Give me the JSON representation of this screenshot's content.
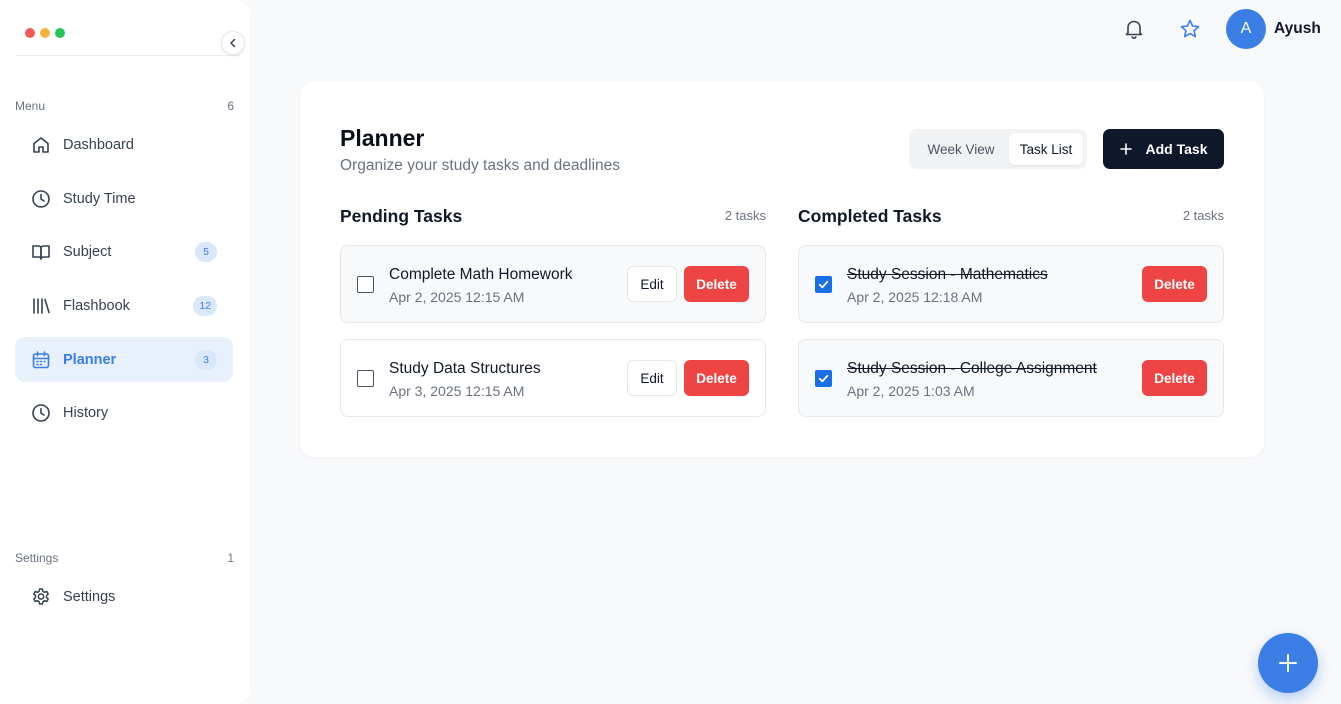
{
  "window": {
    "dot_colors": [
      "#ef5b5b",
      "#f5b53d",
      "#22c55e"
    ]
  },
  "sidebar": {
    "menu_label": "Menu",
    "menu_count": "6",
    "items": [
      {
        "label": "Dashboard",
        "icon": "home-icon",
        "badge": null,
        "active": false
      },
      {
        "label": "Study Time",
        "icon": "clock-icon",
        "badge": null,
        "active": false
      },
      {
        "label": "Subject",
        "icon": "book-icon",
        "badge": "5",
        "active": false
      },
      {
        "label": "Flashbook",
        "icon": "library-icon",
        "badge": "12",
        "active": false
      },
      {
        "label": "Planner",
        "icon": "calendar-icon",
        "badge": "3",
        "active": true
      },
      {
        "label": "History",
        "icon": "clock-icon",
        "badge": null,
        "active": false
      }
    ],
    "settings_label": "Settings",
    "settings_count": "1",
    "settings_items": [
      {
        "label": "Settings",
        "icon": "gear-icon"
      }
    ]
  },
  "topbar": {
    "bell_icon": "bell-icon",
    "star_icon": "star-icon",
    "avatar_initial": "A",
    "user_name": "Ayush"
  },
  "planner": {
    "title": "Planner",
    "subtitle": "Organize your study tasks and deadlines",
    "view_toggle": {
      "week": "Week View",
      "list": "Task List",
      "selected": "Task List"
    },
    "add_task_label": "Add Task"
  },
  "pending": {
    "title": "Pending Tasks",
    "count": "2 tasks",
    "tasks": [
      {
        "title": "Complete Math Homework",
        "date": "Apr 2, 2025 12:15 AM",
        "done": false,
        "edit": "Edit",
        "delete": "Delete"
      },
      {
        "title": "Study Data Structures",
        "date": "Apr 3, 2025 12:15 AM",
        "done": false,
        "edit": "Edit",
        "delete": "Delete"
      }
    ]
  },
  "completed": {
    "title": "Completed Tasks",
    "count": "2 tasks",
    "tasks": [
      {
        "title": "Study Session - Mathematics",
        "date": "Apr 2, 2025 12:18 AM",
        "done": true,
        "delete": "Delete"
      },
      {
        "title": "Study Session - College Assignment",
        "date": "Apr 2, 2025 1:03 AM",
        "done": true,
        "delete": "Delete"
      }
    ]
  },
  "colors": {
    "accent": "#3b7fe6",
    "danger": "#ef4444",
    "dark": "#0f172a"
  }
}
